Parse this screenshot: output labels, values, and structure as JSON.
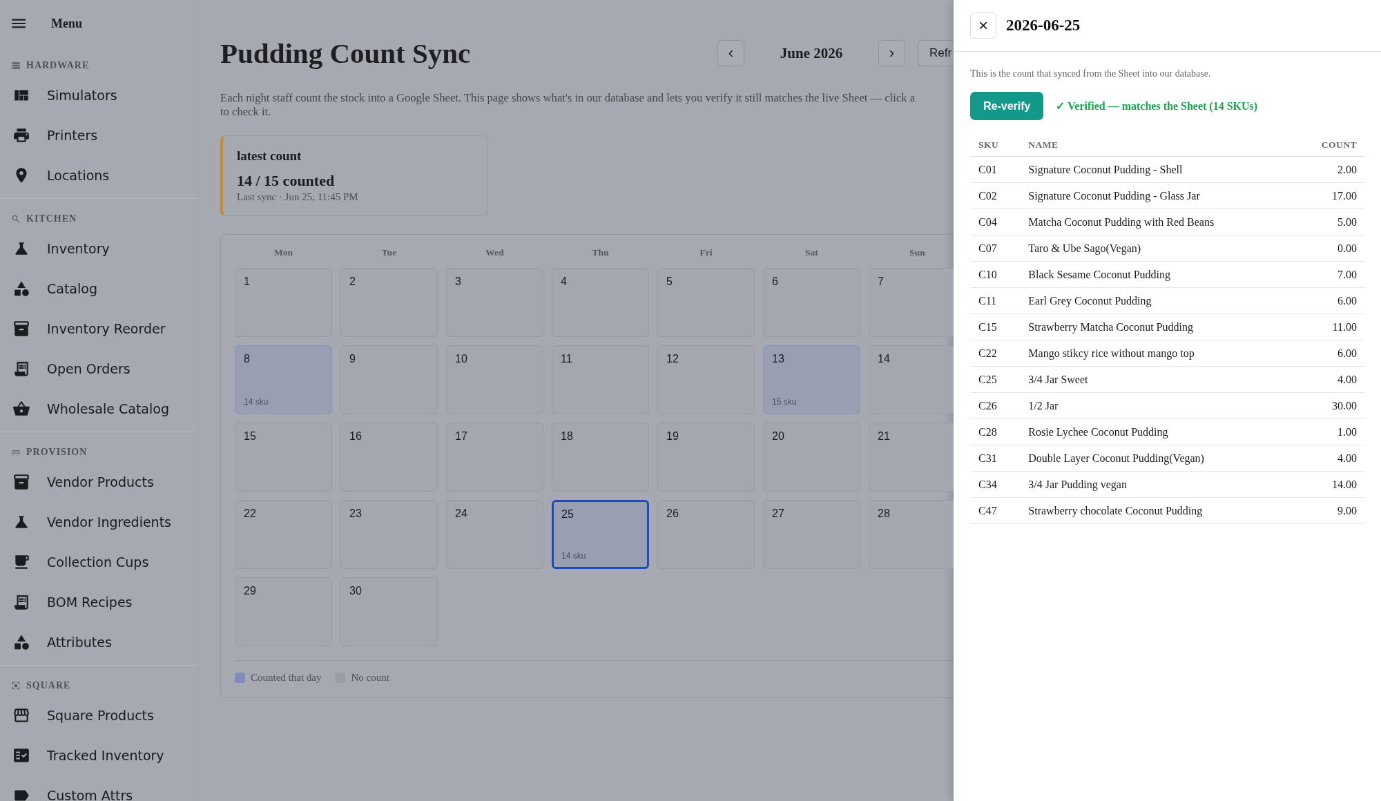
{
  "menu": {
    "label": "Menu"
  },
  "sidebar": {
    "sections": [
      {
        "title": "HARDWARE",
        "kind": "hardware",
        "items": [
          {
            "label": "Simulators",
            "kind": "grid"
          },
          {
            "label": "Printers",
            "kind": "printer"
          },
          {
            "label": "Locations",
            "kind": "pin"
          }
        ]
      },
      {
        "title": "KITCHEN",
        "kind": "search",
        "items": [
          {
            "label": "Inventory",
            "kind": "flask"
          },
          {
            "label": "Catalog",
            "kind": "shapes"
          },
          {
            "label": "Inventory Reorder",
            "kind": "archive"
          },
          {
            "label": "Open Orders",
            "kind": "receipt"
          },
          {
            "label": "Wholesale Catalog",
            "kind": "basket"
          }
        ]
      },
      {
        "title": "PROVISION",
        "kind": "link",
        "items": [
          {
            "label": "Vendor Products",
            "kind": "archive"
          },
          {
            "label": "Vendor Ingredients",
            "kind": "flask"
          },
          {
            "label": "Collection Cups",
            "kind": "cup"
          },
          {
            "label": "BOM Recipes",
            "kind": "receipt"
          },
          {
            "label": "Attributes",
            "kind": "shapes"
          }
        ]
      },
      {
        "title": "SQUARE",
        "kind": "square",
        "items": [
          {
            "label": "Square Products",
            "kind": "store"
          },
          {
            "label": "Tracked Inventory",
            "kind": "check"
          },
          {
            "label": "Custom Attrs",
            "kind": "tag"
          }
        ]
      }
    ]
  },
  "page": {
    "title": "Pudding Count Sync",
    "prev": "‹",
    "month": "June 2026",
    "next": "›",
    "refresh": "Refr",
    "description_lines": [
      "Each night staff count the stock into a Google Sheet. This page shows what's in our database and lets you verify it still matches the live Sheet — click a",
      "to check it."
    ]
  },
  "summary": {
    "title": "latest count",
    "value": "14 / 15 counted",
    "detail": "Last sync · Jun 25, 11:45 PM"
  },
  "calendar": {
    "weekdays": [
      "Mon",
      "Tue",
      "Wed",
      "Thu",
      "Fri",
      "Sat",
      "Sun"
    ],
    "days": [
      {
        "day": "1",
        "counted": false,
        "selected": false
      },
      {
        "day": "2",
        "counted": false,
        "selected": false
      },
      {
        "day": "3",
        "counted": false,
        "selected": false
      },
      {
        "day": "4",
        "counted": false,
        "selected": false
      },
      {
        "day": "5",
        "counted": false,
        "selected": false
      },
      {
        "day": "6",
        "counted": false,
        "selected": false
      },
      {
        "day": "7",
        "counted": false,
        "selected": false
      },
      {
        "day": "8",
        "counted": true,
        "sku": "14 sku",
        "selected": false
      },
      {
        "day": "9",
        "counted": false,
        "selected": false
      },
      {
        "day": "10",
        "counted": false,
        "selected": false
      },
      {
        "day": "11",
        "counted": false,
        "selected": false
      },
      {
        "day": "12",
        "counted": false,
        "selected": false
      },
      {
        "day": "13",
        "counted": true,
        "sku": "15 sku",
        "selected": false
      },
      {
        "day": "14",
        "counted": false,
        "selected": false
      },
      {
        "day": "15",
        "counted": false,
        "selected": false
      },
      {
        "day": "16",
        "counted": false,
        "selected": false
      },
      {
        "day": "17",
        "counted": false,
        "selected": false
      },
      {
        "day": "18",
        "counted": false,
        "selected": false
      },
      {
        "day": "19",
        "counted": false,
        "selected": false
      },
      {
        "day": "20",
        "counted": false,
        "selected": false
      },
      {
        "day": "21",
        "counted": false,
        "selected": false
      },
      {
        "day": "22",
        "counted": false,
        "selected": false
      },
      {
        "day": "23",
        "counted": false,
        "selected": false
      },
      {
        "day": "24",
        "counted": false,
        "selected": false
      },
      {
        "day": "25",
        "counted": true,
        "sku": "14 sku",
        "selected": true
      },
      {
        "day": "26",
        "counted": false,
        "selected": false
      },
      {
        "day": "27",
        "counted": false,
        "selected": false
      },
      {
        "day": "28",
        "counted": false,
        "selected": false
      },
      {
        "day": "29",
        "counted": false,
        "selected": false
      },
      {
        "day": "30",
        "counted": false,
        "selected": false
      }
    ],
    "legend": [
      {
        "label": "Counted that day",
        "color": "#7f8dbe"
      },
      {
        "label": "No count",
        "color": "#9a9ca6"
      }
    ]
  },
  "drawer": {
    "title": "2026-06-25",
    "close": "×",
    "description": "This is the count that synced from the Sheet into our database.",
    "button": "Re-verify",
    "status": "✓ Verified — matches the Sheet (14 SKUs)",
    "columns": [
      "SKU",
      "NAME",
      "COUNT"
    ],
    "rows": [
      [
        "C01",
        "Signature Coconut Pudding - Shell",
        "2.00"
      ],
      [
        "C02",
        "Signature Coconut Pudding - Glass Jar",
        "17.00"
      ],
      [
        "C04",
        "Matcha Coconut Pudding with Red Beans",
        "5.00"
      ],
      [
        "C07",
        "Taro & Ube Sago(Vegan)",
        "0.00"
      ],
      [
        "C10",
        "Black Sesame Coconut Pudding",
        "7.00"
      ],
      [
        "C11",
        "Earl Grey Coconut Pudding",
        "6.00"
      ],
      [
        "C15",
        "Strawberry Matcha Coconut Pudding",
        "11.00"
      ],
      [
        "C22",
        "Mango stikcy rice without mango top",
        "6.00"
      ],
      [
        "C25",
        "3/4 Jar Sweet",
        "4.00"
      ],
      [
        "C26",
        "1/2 Jar",
        "30.00"
      ],
      [
        "C28",
        "Rosie Lychee Coconut Pudding",
        "1.00"
      ],
      [
        "C31",
        "Double Layer Coconut Pudding(Vegan)",
        "4.00"
      ],
      [
        "C34",
        "3/4 Jar Pudding vegan",
        "14.00"
      ],
      [
        "C47",
        "Strawberry chocolate Coconut Pudding",
        "9.00"
      ]
    ]
  }
}
